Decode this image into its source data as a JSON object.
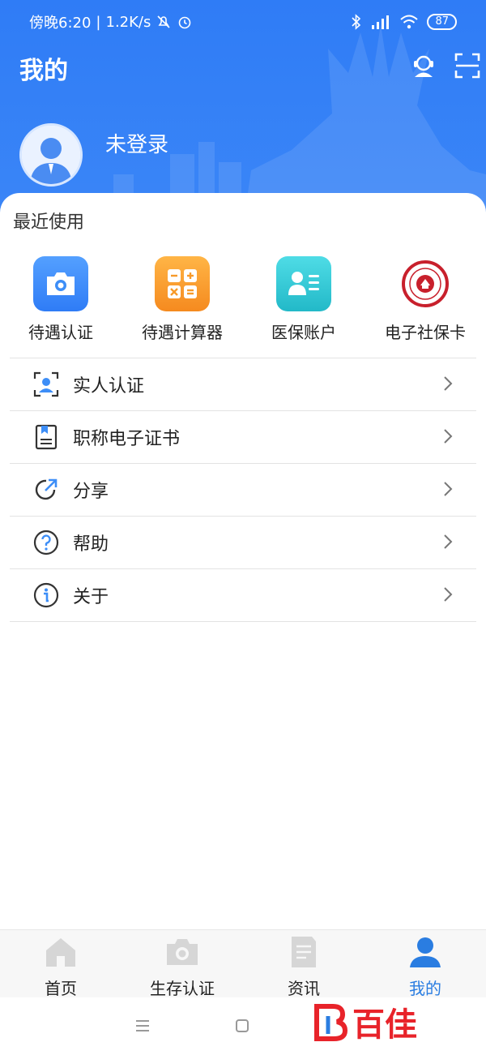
{
  "status_bar": {
    "time": "傍晚6:20",
    "net_speed": "1.2K/s",
    "battery": "87"
  },
  "header": {
    "title": "我的",
    "login_label": "未登录"
  },
  "recent": {
    "title": "最近使用",
    "apps": [
      {
        "label": "待遇认证",
        "icon": "camera-icon",
        "color": "#3d8ef7"
      },
      {
        "label": "待遇计算器",
        "icon": "calculator-icon",
        "color": "#f79a2a"
      },
      {
        "label": "医保账户",
        "icon": "contact-card-icon",
        "color": "#2fcad6"
      },
      {
        "label": "电子社保卡",
        "icon": "social-security-card-icon",
        "color": "#c8202c"
      }
    ]
  },
  "menu": [
    {
      "label": "实人认证",
      "icon": "face-scan-icon"
    },
    {
      "label": "职称电子证书",
      "icon": "certificate-icon"
    },
    {
      "label": "分享",
      "icon": "share-icon"
    },
    {
      "label": "帮助",
      "icon": "help-icon"
    },
    {
      "label": "关于",
      "icon": "info-icon"
    }
  ],
  "tabbar": [
    {
      "label": "首页",
      "icon": "home-icon",
      "active": false
    },
    {
      "label": "生存认证",
      "icon": "camera-icon",
      "active": false
    },
    {
      "label": "资讯",
      "icon": "document-icon",
      "active": false
    },
    {
      "label": "我的",
      "icon": "user-icon",
      "active": true
    }
  ],
  "watermark": "百佳",
  "colors": {
    "primary": "#2f7cf6",
    "tab_active": "#2a7de1"
  }
}
